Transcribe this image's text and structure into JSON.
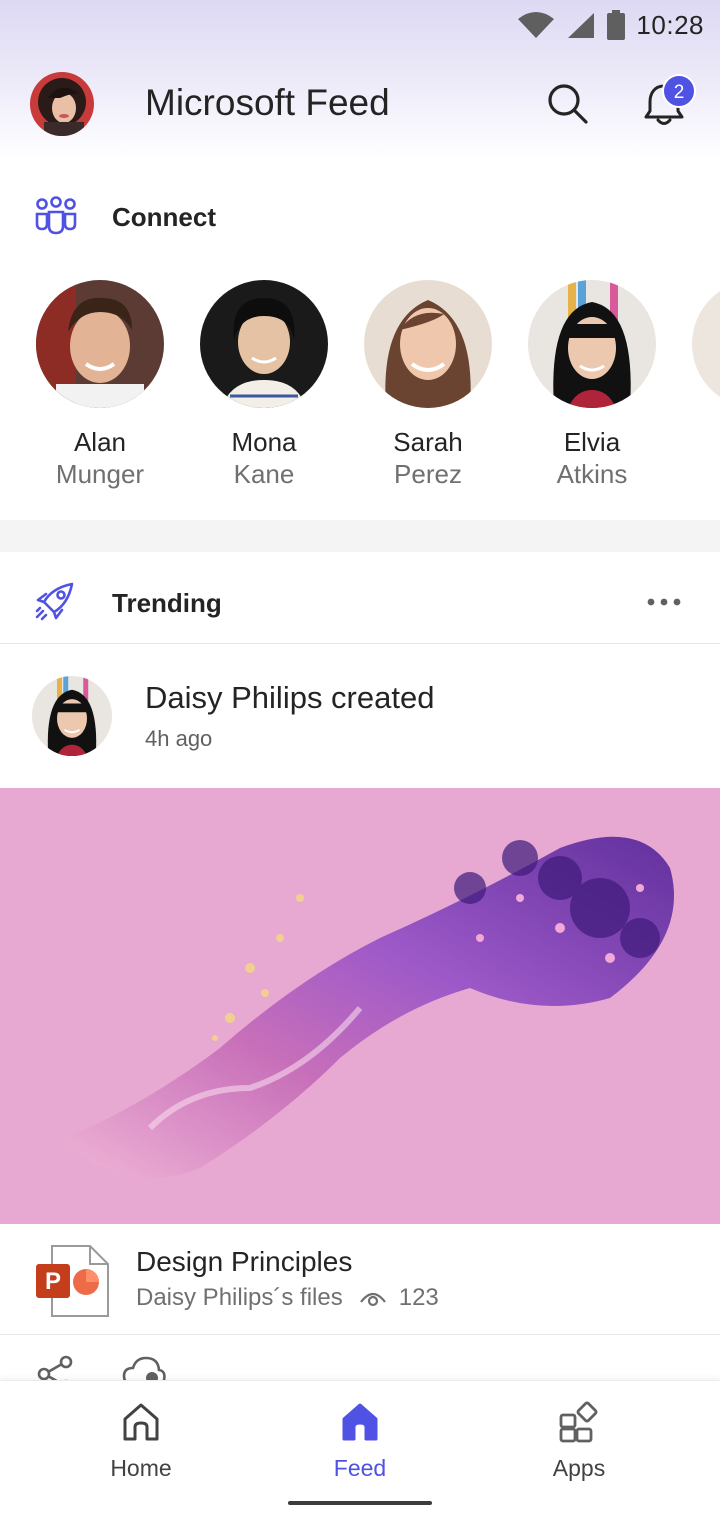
{
  "status_bar": {
    "time": "10:28"
  },
  "header": {
    "title": "Microsoft Feed",
    "notification_count": "2"
  },
  "connect": {
    "label": "Connect",
    "people": [
      {
        "first": "Alan",
        "last": "Munger"
      },
      {
        "first": "Mona",
        "last": "Kane"
      },
      {
        "first": "Sarah",
        "last": "Perez"
      },
      {
        "first": "Elvia",
        "last": "Atkins"
      }
    ]
  },
  "trending": {
    "label": "Trending",
    "post": {
      "title": "Daisy Philips created",
      "time": "4h ago",
      "file": {
        "name": "Design Principles",
        "location": "Daisy Philips´s files",
        "views": "123"
      }
    }
  },
  "nav": {
    "items": [
      {
        "label": "Home"
      },
      {
        "label": "Feed"
      },
      {
        "label": "Apps"
      }
    ],
    "active": "Feed"
  },
  "colors": {
    "accent": "#4f52e2",
    "hero_background": "#e7a9d2",
    "powerpoint": "#c43e1c"
  }
}
